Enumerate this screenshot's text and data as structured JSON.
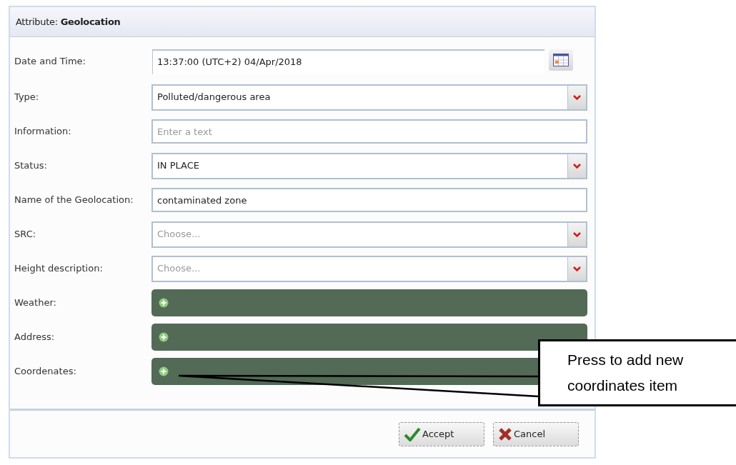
{
  "dialog": {
    "title": "Attribute: **Geolocation**",
    "fields": [
      {
        "kind": "datetime",
        "label": "Date and Time:",
        "value": "13:37:00 (UTC+2) 04/Apr/2018"
      },
      {
        "kind": "select",
        "label": "Type:",
        "value": "Polluted/dangerous area"
      },
      {
        "kind": "text",
        "label": "Information:",
        "placeholder": "Enter a text"
      },
      {
        "kind": "select",
        "label": "Status:",
        "value": "IN PLACE"
      },
      {
        "kind": "text",
        "label": "Name of the Geolocation:",
        "value": "contaminated zone"
      },
      {
        "kind": "select",
        "label": "SRC:",
        "placeholder": "Choose..."
      },
      {
        "kind": "select",
        "label": "Height description:",
        "placeholder": "Choose..."
      },
      {
        "kind": "section",
        "label": "Weather:"
      },
      {
        "kind": "section",
        "label": "Address:"
      },
      {
        "kind": "section",
        "label": "Coordenates:"
      }
    ],
    "buttons": [
      {
        "kind": "accept",
        "label": "Accept"
      },
      {
        "kind": "cancel",
        "label": "Cancel"
      }
    ]
  },
  "callout": {
    "text": "Press to add new coordinates item"
  }
}
